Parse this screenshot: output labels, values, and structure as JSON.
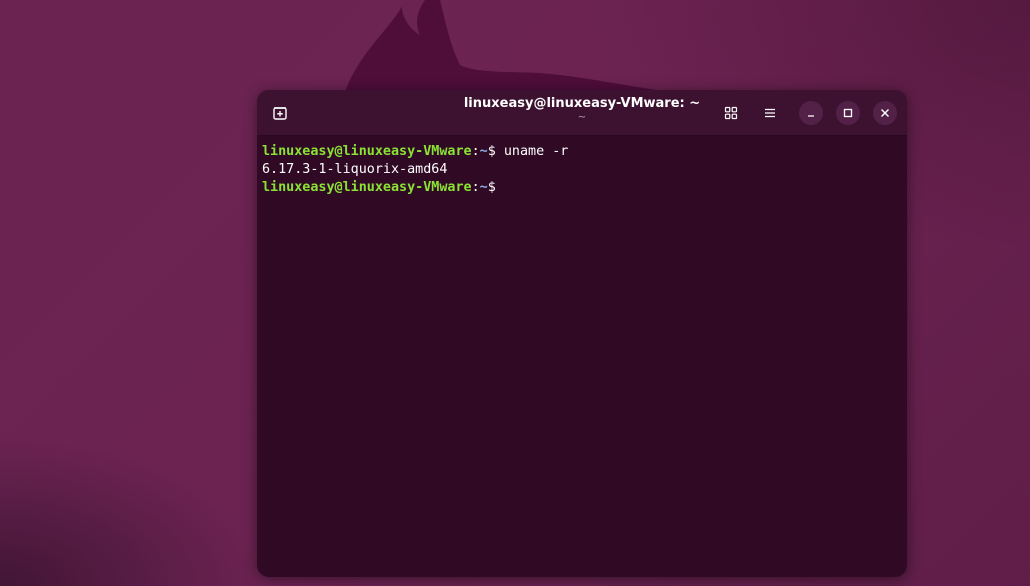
{
  "desktop": {
    "background_color": "#6a2350"
  },
  "window": {
    "title": "linuxeasy@linuxeasy-VMware: ~",
    "subtitle": "~",
    "new_tab_icon": "new-tab-icon",
    "view_icon": "grid-view-icon",
    "menu_icon": "hamburger-menu-icon",
    "minimize_icon": "minimize-icon",
    "maximize_icon": "maximize-icon",
    "close_icon": "close-icon"
  },
  "terminal": {
    "background": "#300a24",
    "prompt_color": "#8ae234",
    "path_color": "#8ab0e8",
    "lines": [
      {
        "user_host": "linuxeasy@linuxeasy-VMware",
        "colon": ":",
        "path": "~",
        "symbol": "$",
        "command": " uname -r"
      },
      {
        "output": "6.17.3-1-liquorix-amd64"
      },
      {
        "user_host": "linuxeasy@linuxeasy-VMware",
        "colon": ":",
        "path": "~",
        "symbol": "$",
        "command": ""
      }
    ]
  }
}
